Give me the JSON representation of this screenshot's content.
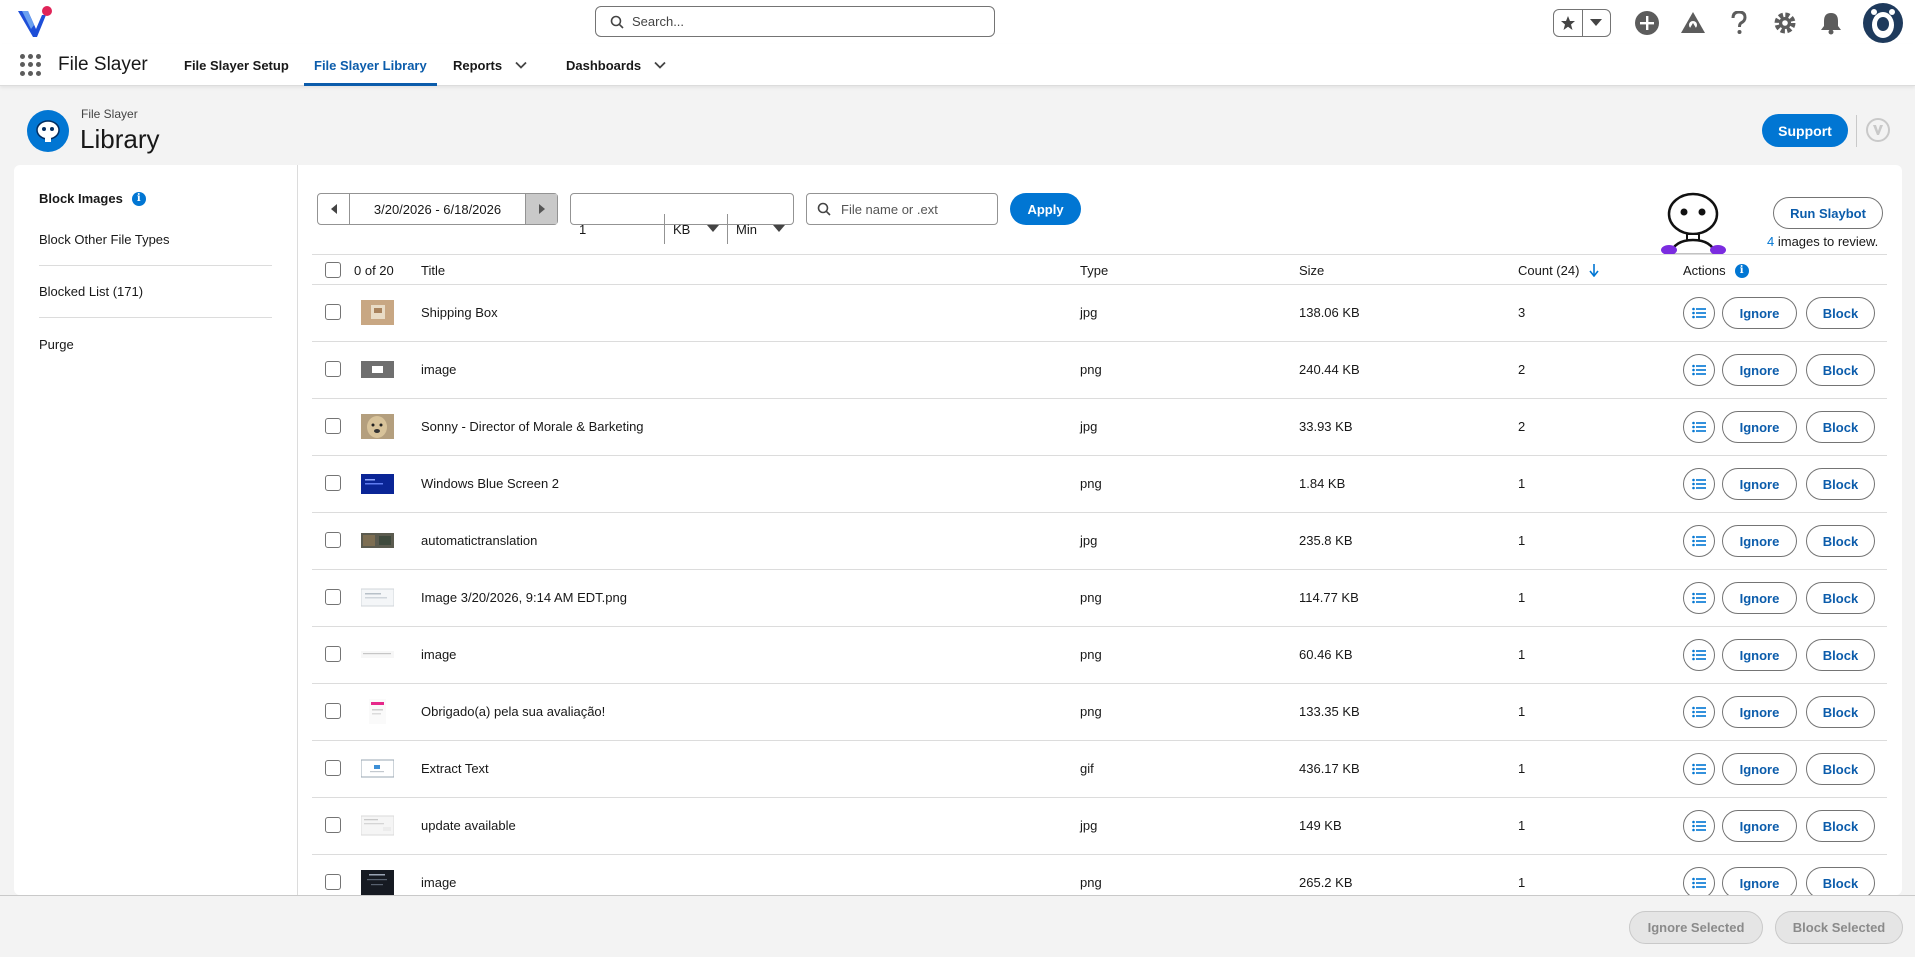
{
  "global_header": {
    "search_placeholder": "Search...",
    "icons": [
      "star-icon",
      "add-icon",
      "trailhead-icon",
      "help-icon",
      "gear-icon",
      "bell-icon",
      "avatar"
    ]
  },
  "nav": {
    "app_name": "File Slayer",
    "items": [
      {
        "label": "File Slayer Setup",
        "active": false,
        "dropdown": false
      },
      {
        "label": "File Slayer Library",
        "active": true,
        "dropdown": false
      },
      {
        "label": "Reports",
        "active": false,
        "dropdown": true
      },
      {
        "label": "Dashboards",
        "active": false,
        "dropdown": true
      }
    ]
  },
  "page": {
    "eyebrow": "File Slayer",
    "title": "Library",
    "support_label": "Support"
  },
  "sidebar": {
    "items": [
      {
        "label": "Block Images",
        "selected": true,
        "info": true
      },
      {
        "label": "Block Other File Types",
        "selected": false
      },
      {
        "label": "Blocked List (171)",
        "selected": false
      },
      {
        "label": "Purge",
        "selected": false
      }
    ]
  },
  "filters": {
    "date_range": "3/20/2026 - 6/18/2026",
    "size_value": "1",
    "size_unit": "KB",
    "size_mode": "Min",
    "file_search_placeholder": "File name or .ext",
    "apply_label": "Apply"
  },
  "slaybot": {
    "run_label": "Run Slaybot",
    "review_count": "4",
    "review_text": " images to review."
  },
  "table": {
    "selection_count": "0 of 20",
    "columns": {
      "title": "Title",
      "type": "Type",
      "size": "Size",
      "count": "Count (24)",
      "actions": "Actions"
    },
    "ignore_label": "Ignore",
    "block_label": "Block",
    "rows": [
      {
        "title": "Shipping Box",
        "type": "jpg",
        "size": "138.06 KB",
        "count": "3"
      },
      {
        "title": "image",
        "type": "png",
        "size": "240.44 KB",
        "count": "2"
      },
      {
        "title": "Sonny - Director of Morale & Barketing",
        "type": "jpg",
        "size": "33.93 KB",
        "count": "2"
      },
      {
        "title": "Windows Blue Screen 2",
        "type": "png",
        "size": "1.84 KB",
        "count": "1"
      },
      {
        "title": "automatictranslation",
        "type": "jpg",
        "size": "235.8 KB",
        "count": "1"
      },
      {
        "title": "Image 3/20/2026, 9:14 AM EDT.png",
        "type": "png",
        "size": "114.77 KB",
        "count": "1"
      },
      {
        "title": "image",
        "type": "png",
        "size": "60.46 KB",
        "count": "1"
      },
      {
        "title": "Obrigado(a) pela sua avaliação!",
        "type": "png",
        "size": "133.35 KB",
        "count": "1"
      },
      {
        "title": "Extract Text",
        "type": "gif",
        "size": "436.17 KB",
        "count": "1"
      },
      {
        "title": "update available",
        "type": "jpg",
        "size": "149 KB",
        "count": "1"
      },
      {
        "title": "image",
        "type": "png",
        "size": "265.2 KB",
        "count": "1"
      }
    ]
  },
  "footer": {
    "ignore_selected": "Ignore Selected",
    "block_selected": "Block Selected"
  },
  "colors": {
    "brand_blue": "#0176d3",
    "link_blue": "#0b5cab",
    "border": "#dcdcdc"
  }
}
